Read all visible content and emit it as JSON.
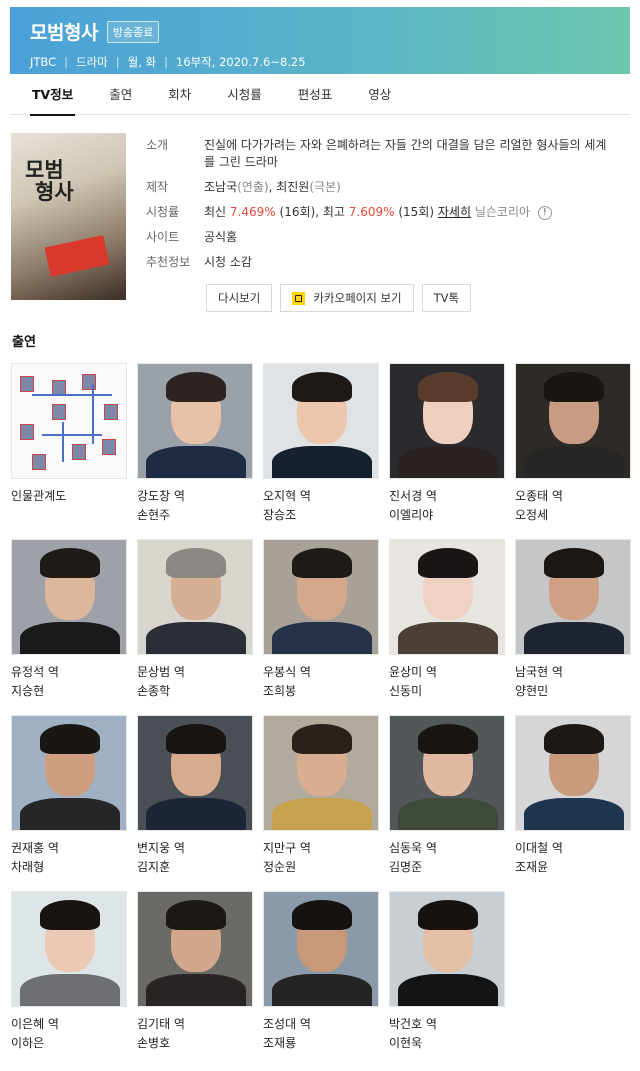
{
  "header": {
    "title": "모범형사",
    "status_badge": "방송종료",
    "channel": "JTBC",
    "genre": "드라마",
    "days": "월, 화",
    "episodes_period": "16부작, 2020.7.6~8.25"
  },
  "tabs": [
    {
      "label": "TV정보",
      "active": true
    },
    {
      "label": "출연",
      "active": false
    },
    {
      "label": "회차",
      "active": false
    },
    {
      "label": "시청률",
      "active": false
    },
    {
      "label": "편성표",
      "active": false
    },
    {
      "label": "영상",
      "active": false
    }
  ],
  "poster": {
    "title_line1": "모범",
    "title_line2": "형사"
  },
  "info": {
    "intro_label": "소개",
    "intro_text": "진실에 다가가려는 자와 은폐하려는 자들 간의 대결을 담은 리얼한 형사들의 세계를 그린 드라마",
    "production_label": "제작",
    "director_name": "조남국",
    "director_role": "(연출)",
    "writer_name": "최진원",
    "writer_role": "(극본)",
    "rating_label": "시청률",
    "rating_low_prefix": "최신",
    "rating_low": "7.469%",
    "rating_low_ep": "(16회)",
    "rating_high_prefix": "최고",
    "rating_high": "7.609%",
    "rating_high_ep": "(15회)",
    "rating_more": "자세히",
    "rating_source": "닐슨코리아",
    "site_label": "사이트",
    "site_value": "공식홈",
    "recommend_label": "추천정보",
    "recommend_value": "시청 소감"
  },
  "buttons": {
    "rewatch": "다시보기",
    "kakao": "카카오페이지 보기",
    "tvtalk": "TV톡"
  },
  "cast_section_title": "출연",
  "cast": [
    {
      "role": "인물관계도",
      "actor": ""
    },
    {
      "role": "강도창 역",
      "actor": "손현주"
    },
    {
      "role": "오지혁 역",
      "actor": "장승조"
    },
    {
      "role": "진서경 역",
      "actor": "이엘리야"
    },
    {
      "role": "오종태 역",
      "actor": "오정세"
    },
    {
      "role": "유정석 역",
      "actor": "지승현"
    },
    {
      "role": "문상범 역",
      "actor": "손종학"
    },
    {
      "role": "우봉식 역",
      "actor": "조희봉"
    },
    {
      "role": "윤상미 역",
      "actor": "신동미"
    },
    {
      "role": "남국현 역",
      "actor": "양현민"
    },
    {
      "role": "권재홍 역",
      "actor": "차래형"
    },
    {
      "role": "변지웅 역",
      "actor": "김지훈"
    },
    {
      "role": "지만구 역",
      "actor": "정순원"
    },
    {
      "role": "심동욱 역",
      "actor": "김명준"
    },
    {
      "role": "이대철 역",
      "actor": "조재윤"
    },
    {
      "role": "이은혜 역",
      "actor": "이하은"
    },
    {
      "role": "김기태 역",
      "actor": "손병호"
    },
    {
      "role": "조성대 역",
      "actor": "조재룡"
    },
    {
      "role": "박건호 역",
      "actor": "이현욱"
    }
  ],
  "colors": {
    "header_gradient_start": "#4aa0d8",
    "header_gradient_end": "#6cc7ad",
    "rating_red": "#e8473b",
    "kakao_yellow": "#ffd400"
  }
}
